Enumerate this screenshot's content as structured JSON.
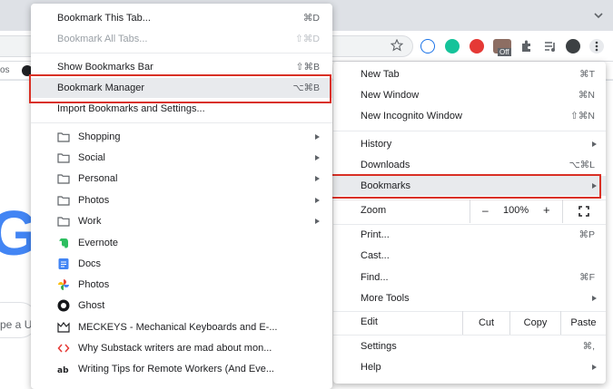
{
  "bookmark_menu": {
    "top_items": [
      {
        "label": "Bookmark This Tab...",
        "shortcut": "⌘D"
      },
      {
        "label": "Bookmark All Tabs...",
        "shortcut": "⇧⌘D"
      },
      {
        "label": "Show Bookmarks Bar",
        "shortcut": "⇧⌘B"
      },
      {
        "label": "Bookmark Manager",
        "shortcut": "⌥⌘B"
      },
      {
        "label": "Import Bookmarks and Settings..."
      }
    ],
    "links": [
      {
        "label": "Shopping",
        "icon": "folder-icon"
      },
      {
        "label": "Social",
        "icon": "folder-icon"
      },
      {
        "label": "Personal",
        "icon": "folder-icon"
      },
      {
        "label": "Photos",
        "icon": "folder-icon"
      },
      {
        "label": "Work",
        "icon": "folder-icon"
      },
      {
        "label": "Evernote",
        "icon": "evernote-icon"
      },
      {
        "label": "Docs",
        "icon": "docs-icon"
      },
      {
        "label": "Photos",
        "icon": "photos-icon"
      },
      {
        "label": "Ghost",
        "icon": "ghost-icon"
      },
      {
        "label": "MECKEYS - Mechanical Keyboards and E-...",
        "icon": "keyboard-icon"
      },
      {
        "label": "Why Substack writers are mad about mon...",
        "icon": "code-icon"
      },
      {
        "label": "Writing Tips for Remote Workers (And Eve...",
        "icon": "ab-icon"
      }
    ]
  },
  "chrome_menu": {
    "items": {
      "new_tab": {
        "label": "New Tab",
        "shortcut": "⌘T"
      },
      "new_window": {
        "label": "New Window",
        "shortcut": "⌘N"
      },
      "incognito": {
        "label": "New Incognito Window",
        "shortcut": "⇧⌘N"
      },
      "history": {
        "label": "History"
      },
      "downloads": {
        "label": "Downloads",
        "shortcut": "⌥⌘L"
      },
      "bookmarks": {
        "label": "Bookmarks"
      },
      "print": {
        "label": "Print...",
        "shortcut": "⌘P"
      },
      "cast": {
        "label": "Cast..."
      },
      "find": {
        "label": "Find...",
        "shortcut": "⌘F"
      },
      "more_tools": {
        "label": "More Tools"
      },
      "settings": {
        "label": "Settings",
        "shortcut": "⌘,"
      },
      "help": {
        "label": "Help"
      }
    },
    "zoom": {
      "label": "Zoom",
      "minus": "–",
      "value": "100%",
      "plus": "+"
    },
    "edit": {
      "label": "Edit",
      "cut": "Cut",
      "copy": "Copy",
      "paste": "Paste"
    }
  },
  "background": {
    "bookmarks_bar_fragment": "os",
    "search_fragment": "pe a U",
    "google_fragment": "G"
  },
  "extensions": {
    "off_badge": "Off"
  },
  "colors": {
    "highlight": "#d93025",
    "google_blue": "#4285f4",
    "evernote_green": "#2dbe60",
    "docs_blue": "#4285f4"
  }
}
